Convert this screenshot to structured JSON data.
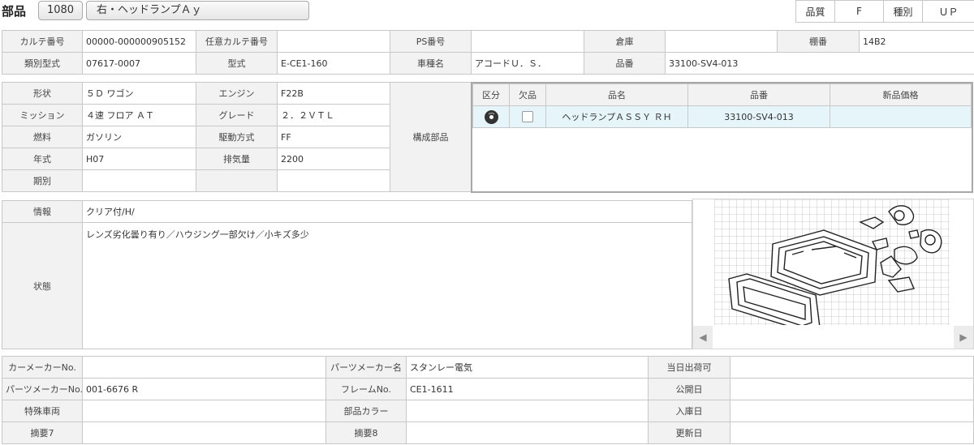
{
  "header": {
    "title": "部品",
    "code": "1080",
    "part_name": "右・ヘッドランプＡｙ",
    "quality_label": "品質",
    "quality_value": "F",
    "type_label": "種別",
    "type_value": "ＵＰ"
  },
  "info_top": {
    "karte_no_label": "カルテ番号",
    "karte_no": "00000-000000905152",
    "opt_karte_label": "任意カルテ番号",
    "opt_karte": "",
    "ps_label": "PS番号",
    "ps": "",
    "warehouse_label": "倉庫",
    "warehouse": "",
    "shelf_label": "棚番",
    "shelf": "14B2",
    "model_class_label": "類別型式",
    "model_class": "07617-0007",
    "model_label": "型式",
    "model": "E-CE1-160",
    "car_name_label": "車種名",
    "car_name": "アコードＵ．Ｓ．",
    "part_no_label": "品番",
    "part_no": "33100-SV4-013"
  },
  "spec": {
    "shape_label": "形状",
    "shape": "５Ｄ ワゴン",
    "engine_label": "エンジン",
    "engine": "F22B",
    "mission_label": "ミッション",
    "mission": "４速 フロア ＡＴ",
    "grade_label": "グレード",
    "grade": "２．２ＶＴＬ",
    "fuel_label": "燃料",
    "fuel": "ガソリン",
    "drive_label": "駆動方式",
    "drive": "FF",
    "year_label": "年式",
    "year": "H07",
    "displacement_label": "排気量",
    "displacement": "2200",
    "period_label": "期別",
    "period": "",
    "components_label": "構成部品"
  },
  "parts_table": {
    "headers": [
      "区分",
      "欠品",
      "品名",
      "品番",
      "新品価格"
    ],
    "rows": [
      {
        "name": "ヘッドランプＡＳＳＹ ＲＨ",
        "number": "33100-SV4-013",
        "price": ""
      }
    ]
  },
  "notes": {
    "info_label": "情報",
    "info": "クリア付/H/",
    "condition_label": "状態",
    "condition": "レンズ劣化曇り有り／ハウジング一部欠け／小キズ多少"
  },
  "bottom": {
    "car_maker_no_label": "カーメーカーNo.",
    "car_maker_no": "",
    "parts_maker_name_label": "パーツメーカー名",
    "parts_maker_name": "スタンレー電気",
    "same_day_label": "当日出荷可",
    "same_day": "",
    "parts_maker_no_label": "パーツメーカーNo.",
    "parts_maker_no": "001-6676 R",
    "frame_no_label": "フレームNo.",
    "frame_no": "CE1-1611",
    "publish_date_label": "公開日",
    "publish_date": "",
    "special_car_label": "特殊車両",
    "special_car": "",
    "part_color_label": "部品カラー",
    "part_color": "",
    "stock_date_label": "入庫日",
    "stock_date": "",
    "summary7_label": "摘要7",
    "summary7": "",
    "summary8_label": "摘要8",
    "summary8": "",
    "update_date_label": "更新日",
    "update_date": ""
  },
  "image_viewer": {
    "prev_icon": "triangle-left-icon",
    "next_icon": "triangle-right-icon",
    "prev_glyph": "◀",
    "next_glyph": "▶"
  }
}
